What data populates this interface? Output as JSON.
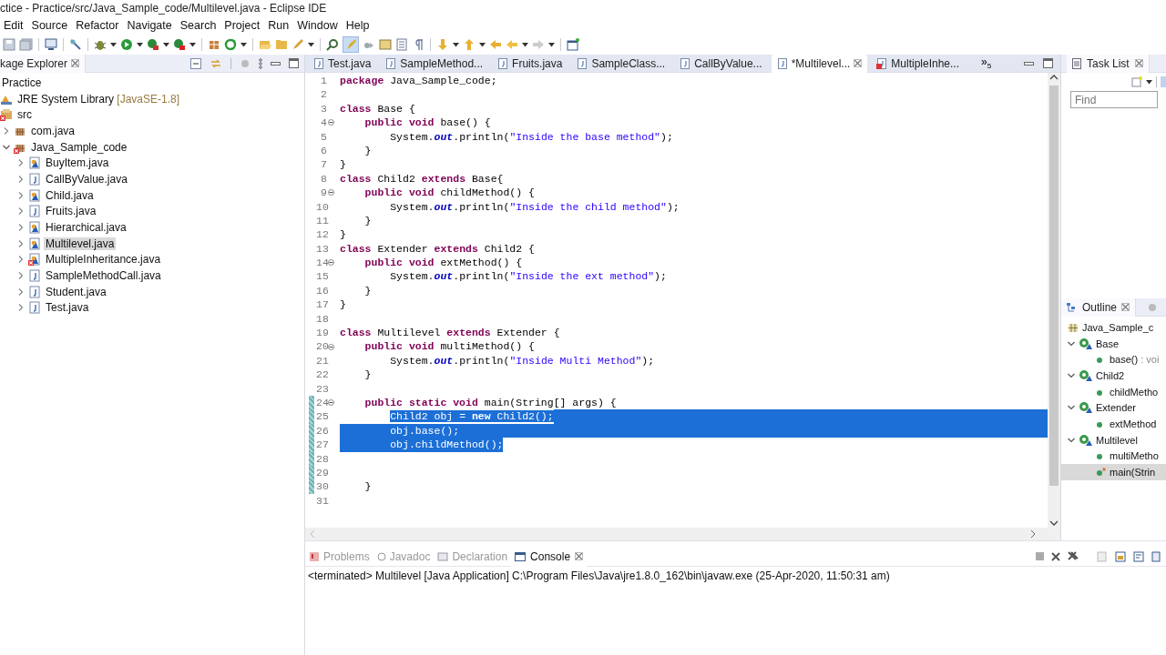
{
  "window": {
    "title": "ctice - Practice/src/Java_Sample_code/Multilevel.java - Eclipse IDE"
  },
  "menu": [
    "Edit",
    "Source",
    "Refactor",
    "Navigate",
    "Search",
    "Project",
    "Run",
    "Window",
    "Help"
  ],
  "package_explorer": {
    "title": "kage Explorer",
    "tree": [
      {
        "label": "Practice",
        "selected": false,
        "children": [
          {
            "label": "JRE System Library",
            "suffix": "[JavaSE-1.8]",
            "kind": "library",
            "selected": false
          },
          {
            "label": "src",
            "kind": "source-folder",
            "error": true,
            "selected": false,
            "children": [
              {
                "label": "com.java",
                "kind": "package",
                "expanded": false,
                "selected": false
              },
              {
                "label": "Java_Sample_code",
                "kind": "package",
                "error": true,
                "expanded": true,
                "selected": false,
                "children": [
                  {
                    "label": "BuyItem.java",
                    "kind": "class-file",
                    "expanded": false,
                    "selected": false
                  },
                  {
                    "label": "CallByValue.java",
                    "kind": "java-file",
                    "expanded": false,
                    "selected": false
                  },
                  {
                    "label": "Child.java",
                    "kind": "class-file",
                    "expanded": false,
                    "selected": false
                  },
                  {
                    "label": "Fruits.java",
                    "kind": "java-file",
                    "expanded": false,
                    "selected": false
                  },
                  {
                    "label": "Hierarchical.java",
                    "kind": "class-file",
                    "expanded": false,
                    "selected": false
                  },
                  {
                    "label": "Multilevel.java",
                    "kind": "class-file",
                    "expanded": false,
                    "selected": true
                  },
                  {
                    "label": "MultipleInheritance.java",
                    "kind": "class-file",
                    "error": true,
                    "expanded": false,
                    "selected": false
                  },
                  {
                    "label": "SampleMethodCall.java",
                    "kind": "java-file",
                    "expanded": false,
                    "selected": false
                  },
                  {
                    "label": "Student.java",
                    "kind": "java-file",
                    "expanded": false,
                    "selected": false
                  },
                  {
                    "label": "Test.java",
                    "kind": "java-file",
                    "expanded": false,
                    "selected": false
                  }
                ]
              }
            ]
          }
        ]
      }
    ]
  },
  "editor": {
    "tabs": [
      {
        "label": "Test.java",
        "selected": false
      },
      {
        "label": "SampleMethod...",
        "selected": false
      },
      {
        "label": "Fruits.java",
        "selected": false
      },
      {
        "label": "SampleClass...",
        "selected": false
      },
      {
        "label": "CallByValue...",
        "selected": false
      },
      {
        "label": "*Multilevel...",
        "selected": true
      },
      {
        "label": "MultipleInhe...",
        "selected": false,
        "error": true
      }
    ],
    "overflow": "»$_{5}$",
    "lines": [
      {
        "n": "1",
        "segs": [
          {
            "kind": "kw",
            "text": "package"
          },
          {
            "kind": "txt",
            "text": " Java_Sample_code;"
          }
        ]
      },
      {
        "n": "2"
      },
      {
        "n": "3",
        "segs": [
          {
            "kind": "kw",
            "text": "class"
          },
          {
            "kind": "txt",
            "text": " Base {"
          }
        ]
      },
      {
        "n": "4",
        "fold": true,
        "segs": [
          {
            "kind": "kw",
            "text": "    public void"
          },
          {
            "kind": "txt",
            "text": " base() {"
          }
        ]
      },
      {
        "n": "5",
        "segs": [
          {
            "kind": "txt",
            "text": "        System."
          },
          {
            "kind": "field",
            "text": "out"
          },
          {
            "kind": "txt",
            "text": ".println("
          },
          {
            "kind": "str",
            "text": "\"Inside the base method\""
          },
          {
            "kind": "txt",
            "text": ");"
          }
        ]
      },
      {
        "n": "6",
        "segs": [
          {
            "kind": "txt",
            "text": "    }"
          }
        ]
      },
      {
        "n": "7",
        "segs": [
          {
            "kind": "txt",
            "text": "}"
          }
        ]
      },
      {
        "n": "8",
        "segs": [
          {
            "kind": "kw",
            "text": "class"
          },
          {
            "kind": "txt",
            "text": " Child2 "
          },
          {
            "kind": "kw",
            "text": "extends"
          },
          {
            "kind": "txt",
            "text": " Base{"
          }
        ]
      },
      {
        "n": "9",
        "fold": true,
        "segs": [
          {
            "kind": "kw",
            "text": "    public void"
          },
          {
            "kind": "txt",
            "text": " childMethod() {"
          }
        ]
      },
      {
        "n": "10",
        "segs": [
          {
            "kind": "txt",
            "text": "        System."
          },
          {
            "kind": "field",
            "text": "out"
          },
          {
            "kind": "txt",
            "text": ".println("
          },
          {
            "kind": "str",
            "text": "\"Inside the child method\""
          },
          {
            "kind": "txt",
            "text": ");"
          }
        ]
      },
      {
        "n": "11",
        "segs": [
          {
            "kind": "txt",
            "text": "    }"
          }
        ]
      },
      {
        "n": "12",
        "segs": [
          {
            "kind": "txt",
            "text": "}"
          }
        ]
      },
      {
        "n": "13",
        "segs": [
          {
            "kind": "kw",
            "text": "class"
          },
          {
            "kind": "txt",
            "text": " Extender "
          },
          {
            "kind": "kw",
            "text": "extends"
          },
          {
            "kind": "txt",
            "text": " Child2 {"
          }
        ]
      },
      {
        "n": "14",
        "fold": true,
        "segs": [
          {
            "kind": "kw",
            "text": "    public void"
          },
          {
            "kind": "txt",
            "text": " extMethod() {"
          }
        ]
      },
      {
        "n": "15",
        "segs": [
          {
            "kind": "txt",
            "text": "        System."
          },
          {
            "kind": "field",
            "text": "out"
          },
          {
            "kind": "txt",
            "text": ".println("
          },
          {
            "kind": "str",
            "text": "\"Inside the ext method\""
          },
          {
            "kind": "txt",
            "text": ");"
          }
        ]
      },
      {
        "n": "16",
        "segs": [
          {
            "kind": "txt",
            "text": "    }"
          }
        ]
      },
      {
        "n": "17",
        "segs": [
          {
            "kind": "txt",
            "text": "}"
          }
        ]
      },
      {
        "n": "18"
      },
      {
        "n": "19",
        "segs": [
          {
            "kind": "kw",
            "text": "class"
          },
          {
            "kind": "txt",
            "text": " Multilevel "
          },
          {
            "kind": "kw",
            "text": "extends"
          },
          {
            "kind": "txt",
            "text": " Extender {"
          }
        ]
      },
      {
        "n": "20",
        "fold": true,
        "segs": [
          {
            "kind": "kw",
            "text": "    public void"
          },
          {
            "kind": "txt",
            "text": " multiMethod() {"
          }
        ]
      },
      {
        "n": "21",
        "segs": [
          {
            "kind": "txt",
            "text": "        System."
          },
          {
            "kind": "field",
            "text": "out"
          },
          {
            "kind": "txt",
            "text": ".println("
          },
          {
            "kind": "str",
            "text": "\"Inside Multi Method\""
          },
          {
            "kind": "txt",
            "text": ");"
          }
        ]
      },
      {
        "n": "22",
        "segs": [
          {
            "kind": "txt",
            "text": "    }"
          }
        ]
      },
      {
        "n": "23"
      },
      {
        "n": "24",
        "fold": true,
        "changed": true,
        "segs": [
          {
            "kind": "kw",
            "text": "    public static void"
          },
          {
            "kind": "txt",
            "text": " main(String[] args) {"
          }
        ]
      },
      {
        "n": "25",
        "changed": true,
        "kind": "selection-start",
        "segs": [
          {
            "kind": "txt",
            "text": "        Child2 obj = "
          },
          {
            "kind": "kw",
            "text": "new"
          },
          {
            "kind": "txt",
            "text": " Child2();"
          }
        ]
      },
      {
        "n": "26",
        "changed": true,
        "kind": "selection-middle",
        "segs": [
          {
            "kind": "txt",
            "text": "        obj.base();"
          }
        ]
      },
      {
        "n": "27",
        "changed": true,
        "kind": "selection-end",
        "segs": [
          {
            "kind": "txt",
            "text": "        obj.childMethod();"
          }
        ]
      },
      {
        "n": "28",
        "changed": true
      },
      {
        "n": "29",
        "changed": true
      },
      {
        "n": "30",
        "changed": true,
        "segs": [
          {
            "kind": "txt",
            "text": "    }"
          }
        ]
      },
      {
        "n": "31"
      }
    ]
  },
  "task_list": {
    "title": "Task List",
    "find": {
      "placeholder": "Find"
    }
  },
  "outline": {
    "title": "Outline",
    "items": [
      {
        "label": "Java_Sample_c",
        "kind": "package",
        "selected": false
      },
      {
        "label": "Base",
        "kind": "class",
        "expanded": true,
        "selected": false,
        "children": [
          {
            "label": "base()",
            "type": " : voi",
            "kind": "method",
            "selected": false
          }
        ]
      },
      {
        "label": "Child2",
        "kind": "class",
        "expanded": true,
        "selected": false,
        "children": [
          {
            "label": "childMetho",
            "kind": "method",
            "selected": false
          }
        ]
      },
      {
        "label": "Extender",
        "kind": "class",
        "expanded": true,
        "selected": false,
        "children": [
          {
            "label": "extMethod",
            "kind": "method",
            "selected": false
          }
        ]
      },
      {
        "label": "Multilevel",
        "kind": "class",
        "expanded": true,
        "selected": false,
        "children": [
          {
            "label": "multiMetho",
            "kind": "method",
            "selected": false
          },
          {
            "label": "main(Strin",
            "kind": "method",
            "static": true,
            "selected": true
          }
        ]
      }
    ]
  },
  "console": {
    "tabs": [
      {
        "label": "Problems",
        "selected": false
      },
      {
        "label": "Javadoc",
        "selected": false
      },
      {
        "label": "Declaration",
        "selected": false
      },
      {
        "label": "Console",
        "selected": true
      }
    ],
    "output": "<terminated> Multilevel [Java Application] C:\\Program Files\\Java\\jre1.8.0_162\\bin\\javaw.exe (25-Apr-2020, 11:50:31 am)"
  }
}
